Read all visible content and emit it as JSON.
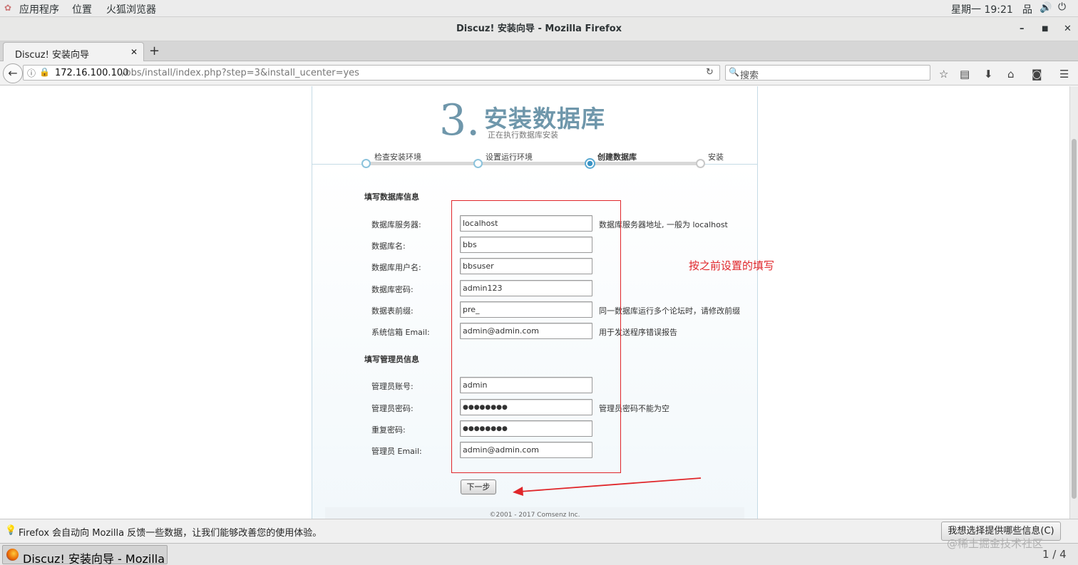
{
  "desktop": {
    "apps_menu": "应用程序",
    "places_menu": "位置",
    "browser_menu": "火狐浏览器",
    "clock": "星期一 19:21"
  },
  "window": {
    "title": "Discuz! 安装向导  -  Mozilla Firefox"
  },
  "tab": {
    "title": "Discuz! 安装向导"
  },
  "navbar": {
    "url_host": "172.16.100.100",
    "url_path": "/bbs/install/index.php?step=3&install_ucenter=yes",
    "search_placeholder": "搜索"
  },
  "wizard": {
    "step_number": "3.",
    "step_title": "安装数据库",
    "step_subtitle": "正在执行数据库安装",
    "steps": [
      {
        "label": "检查安装环境",
        "state": "done"
      },
      {
        "label": "设置运行环境",
        "state": "done"
      },
      {
        "label": "创建数据库",
        "state": "current"
      },
      {
        "label": "安装",
        "state": "todo"
      }
    ]
  },
  "db_section": {
    "heading": "填写数据库信息",
    "fields": [
      {
        "label": "数据库服务器:",
        "value": "localhost",
        "hint": "数据库服务器地址, 一般为 localhost"
      },
      {
        "label": "数据库名:",
        "value": "bbs",
        "hint": ""
      },
      {
        "label": "数据库用户名:",
        "value": "bbsuser",
        "hint": ""
      },
      {
        "label": "数据库密码:",
        "value": "admin123",
        "hint": ""
      },
      {
        "label": "数据表前缀:",
        "value": "pre_",
        "hint": "同一数据库运行多个论坛时，请修改前缀"
      },
      {
        "label": "系统信箱 Email:",
        "value": "admin@admin.com",
        "hint": "用于发送程序错误报告"
      }
    ]
  },
  "admin_section": {
    "heading": "填写管理员信息",
    "fields": [
      {
        "label": "管理员账号:",
        "value": "admin",
        "hint": ""
      },
      {
        "label": "管理员密码:",
        "value": "●●●●●●●●",
        "hint": "管理员密码不能为空"
      },
      {
        "label": "重复密码:",
        "value": "●●●●●●●●",
        "hint": ""
      },
      {
        "label": "管理员 Email:",
        "value": "admin@admin.com",
        "hint": ""
      }
    ]
  },
  "annotation": "按之前设置的填写",
  "next_button": "下一步",
  "footer": "©2001 - 2017 Comsenz Inc.",
  "notification": {
    "text": "Firefox 会自动向 Mozilla 反馈一些数据，让我们能够改善您的使用体验。",
    "button": "我想选择提供哪些信息(C)"
  },
  "taskbar": {
    "item": "Discuz! 安装向导 - Mozilla Firefox",
    "pager": "1 / 4"
  },
  "watermark": "@稀土掘金技术社区",
  "colors": {
    "accent": "#6f97ab",
    "annotation_red": "#e0262a",
    "progress_active": "#3b94c6"
  }
}
